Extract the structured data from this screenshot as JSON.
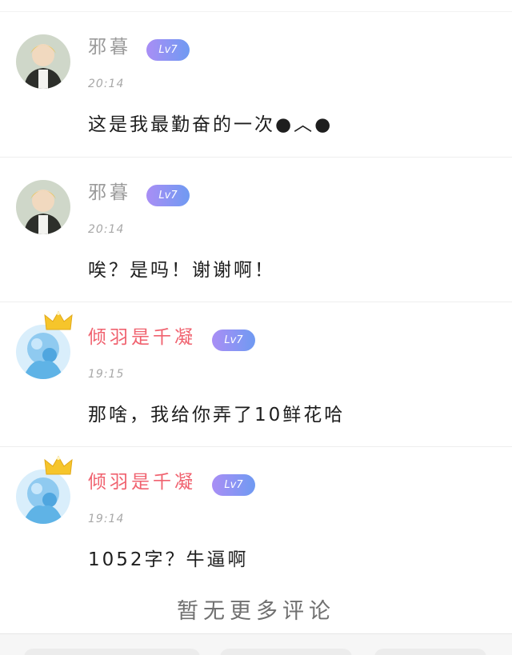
{
  "comments": [
    {
      "name": "邪暮",
      "name_style": "grey",
      "level": "Lv7",
      "time": "20:14",
      "text": "这是我最勤奋的一次●︿●",
      "avatar": "boy-avatar"
    },
    {
      "name": "邪暮",
      "name_style": "grey",
      "level": "Lv7",
      "time": "20:14",
      "text": "唉？是吗！谢谢啊！",
      "avatar": "boy-avatar"
    },
    {
      "name": "倾羽是千凝",
      "name_style": "pink",
      "level": "Lv7",
      "time": "19:15",
      "text": "那啥，我给你弄了10鲜花哈",
      "avatar": "blue-avatar",
      "crown": true
    },
    {
      "name": "倾羽是千凝",
      "name_style": "pink",
      "level": "Lv7",
      "time": "19:14",
      "text": "1052字？牛逼啊",
      "avatar": "blue-avatar",
      "crown": true
    }
  ],
  "footer": {
    "no_more": "暂无更多评论"
  },
  "colors": {
    "level_badge_start": "#a98ef5",
    "level_badge_end": "#6f9af2",
    "vip_name": "#f0626f",
    "normal_name": "#9a9a9a",
    "crown": "#f6c52b"
  }
}
